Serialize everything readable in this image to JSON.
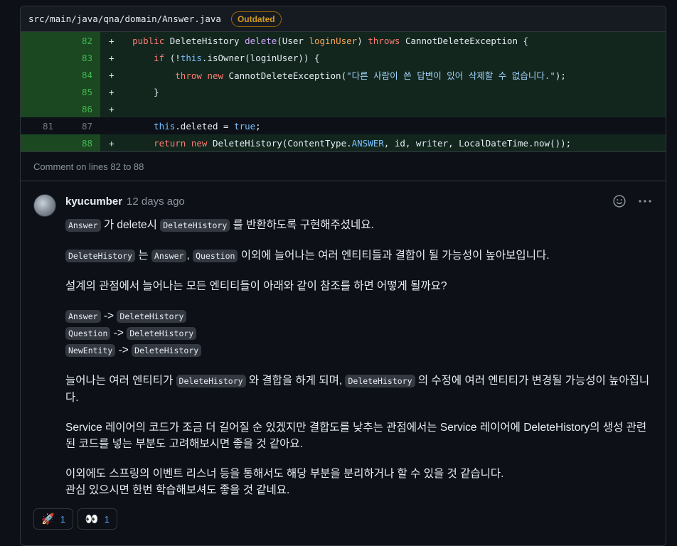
{
  "file": {
    "path": "src/main/java/qna/domain/Answer.java",
    "badge": "Outdated"
  },
  "diff": {
    "lines": [
      {
        "old": "",
        "new": "82",
        "sign": "+",
        "kind": "add"
      },
      {
        "old": "",
        "new": "83",
        "sign": "+",
        "kind": "add"
      },
      {
        "old": "",
        "new": "84",
        "sign": "+",
        "kind": "add"
      },
      {
        "old": "",
        "new": "85",
        "sign": "+",
        "kind": "add"
      },
      {
        "old": "",
        "new": "86",
        "sign": "+",
        "kind": "add"
      },
      {
        "old": "81",
        "new": "87",
        "sign": "",
        "kind": "ctx"
      },
      {
        "old": "",
        "new": "88",
        "sign": "+",
        "kind": "add"
      }
    ],
    "code": {
      "l82": [
        "public",
        "DeleteHistory",
        "delete",
        "(User",
        "loginUser",
        ")",
        "throws",
        "CannotDeleteException",
        "{"
      ],
      "l83": [
        "if",
        "(!",
        "this",
        ".isOwner(loginUser)) {"
      ],
      "l84": [
        "throw",
        "new",
        "CannotDeleteException(",
        "\"다른 사람이 쓴 답변이 있어 삭제할 수 없습니다.\"",
        ");"
      ],
      "l85": [
        "}"
      ],
      "l87": [
        "this",
        ".deleted =",
        "true",
        ";"
      ],
      "l88": [
        "return",
        "new",
        "DeleteHistory(ContentType.",
        "ANSWER",
        ", id, writer, LocalDateTime.now());"
      ]
    }
  },
  "comment_on": "Comment on lines 82 to 88",
  "comment": {
    "author": "kyucumber",
    "time": "12 days ago",
    "icons": {
      "reaction": "smiley-icon",
      "more": "kebab-icon"
    },
    "p1": {
      "t1": "Answer",
      "s1": "가 delete시",
      "t2": "DeleteHistory",
      "s2": "를 반환하도록 구현해주셨네요."
    },
    "p2": {
      "t1": "DeleteHistory",
      "s1": "는",
      "t2": "Answer",
      "s2": ",",
      "t3": "Question",
      "s3": "이외에 늘어나는 여러 엔티티들과 결합이 될 가능성이 높아보입니다."
    },
    "p3": "설계의 관점에서 늘어나는 모든 엔티티들이 아래와 같이 참조를 하면 어떻게 될까요?",
    "chain": [
      {
        "from": "Answer",
        "arrow": "->",
        "to": "DeleteHistory"
      },
      {
        "from": "Question",
        "arrow": "->",
        "to": "DeleteHistory"
      },
      {
        "from": "NewEntity",
        "arrow": "->",
        "to": "DeleteHistory"
      }
    ],
    "p4": {
      "s1": "늘어나는 여러 엔티티가",
      "t1": "DeleteHistory",
      "s2": "와 결합을 하게 되며,",
      "t2": "DeleteHistory",
      "s3": "의 수정에 여러 엔티티가 변경될 가능성이 높아집니다."
    },
    "p5": "Service 레이어의 코드가 조금 더 길어질 순 있겠지만 결합도를 낮추는 관점에서는 Service 레이어에 DeleteHistory의 생성 관련된 코드를 넣는 부분도 고려해보시면 좋을 것 같아요.",
    "p6a": "이외에도 스프링의 이벤트 리스너 등을 통해서도 해당 부분을 분리하거나 할 수 있을 것 같습니다.",
    "p6b": "관심 있으시면 한번 학습해보셔도 좋을 것 같네요.",
    "reactions": [
      {
        "emoji": "🚀",
        "icon": "rocket-icon",
        "count": "1"
      },
      {
        "emoji": "👀",
        "icon": "eyes-icon",
        "count": "1"
      }
    ]
  }
}
